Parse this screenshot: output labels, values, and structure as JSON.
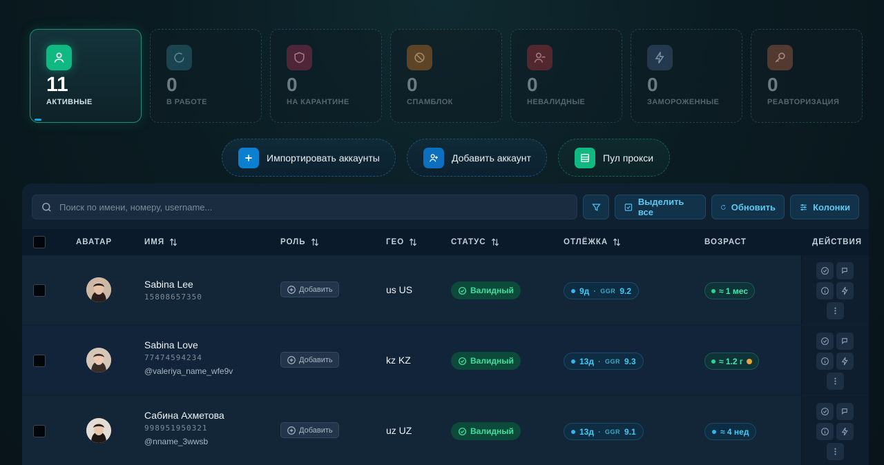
{
  "stats": [
    {
      "value": "11",
      "label": "АКТИВНЫЕ",
      "icon": "user-icon",
      "color": "#10b981"
    },
    {
      "value": "0",
      "label": "В РАБОТЕ",
      "icon": "spinner-icon",
      "color": "#1e4a55"
    },
    {
      "value": "0",
      "label": "НА КАРАНТИНЕ",
      "icon": "shield-icon",
      "color": "#5a2a3e"
    },
    {
      "value": "0",
      "label": "СПАМБЛОК",
      "icon": "ban-icon",
      "color": "#6a4a2a"
    },
    {
      "value": "0",
      "label": "НЕВАЛИДНЫЕ",
      "icon": "user-minus-icon",
      "color": "#5a2e34"
    },
    {
      "value": "0",
      "label": "ЗАМОРОЖЕННЫЕ",
      "icon": "bolt-icon",
      "color": "#2a3f55"
    },
    {
      "value": "0",
      "label": "РЕАВТОРИЗАЦИЯ",
      "icon": "key-icon",
      "color": "#5a3f35"
    }
  ],
  "actions": {
    "import": "Импортировать аккаунты",
    "add": "Добавить аккаунт",
    "proxy": "Пул прокси"
  },
  "toolbar": {
    "search_placeholder": "Поиск по имени, номеру, username...",
    "select_all": "Выделить все",
    "refresh": "Обновить",
    "columns": "Колонки"
  },
  "columns": {
    "avatar": "АВАТАР",
    "name": "ИМЯ",
    "role": "РОЛЬ",
    "geo": "ГЕО",
    "status": "СТАТУС",
    "rest": "ОТЛЁЖКА",
    "age": "ВОЗРАСТ",
    "actions": "ДЕЙСТВИЯ"
  },
  "rows": [
    {
      "name": "Sabina Lee",
      "phone": "15808657350",
      "username": "",
      "role": "Добавить",
      "geo": "us US",
      "status": "Валидный",
      "rest_days": "9д",
      "ggr_label": "GGR",
      "ggr": "9.2",
      "age": "≈ 1 мес",
      "age_coin": false
    },
    {
      "name": "Sabina Love",
      "phone": "77474594234",
      "username": "@valeriya_name_wfe9v",
      "role": "Добавить",
      "geo": "kz KZ",
      "status": "Валидный",
      "rest_days": "13д",
      "ggr_label": "GGR",
      "ggr": "9.3",
      "age": "≈ 1.2 г",
      "age_coin": true
    },
    {
      "name": "Сабина Ахметова",
      "phone": "998951950321",
      "username": "@nname_3wwsb",
      "role": "Добавить",
      "geo": "uz UZ",
      "status": "Валидный",
      "rest_days": "13д",
      "ggr_label": "GGR",
      "ggr": "9.1",
      "age": "≈ 4 нед",
      "age_coin": false
    }
  ]
}
